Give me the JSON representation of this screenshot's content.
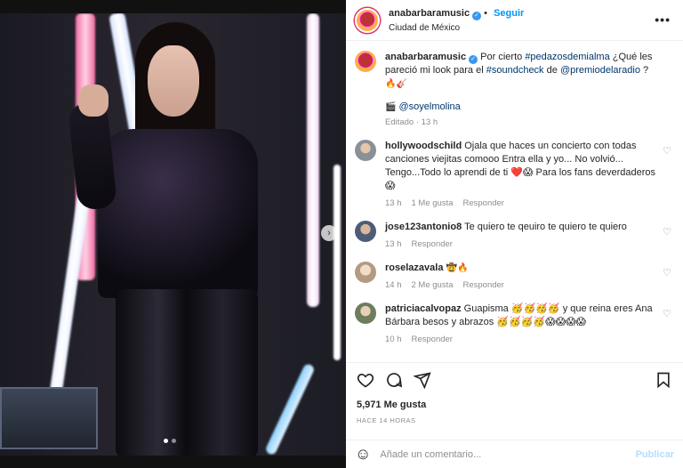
{
  "header": {
    "username": "anabarbaramusic",
    "follow_label": "Seguir",
    "location": "Ciudad de México",
    "more": "•••"
  },
  "caption": {
    "username": "anabarbaramusic",
    "text_1": "Por cierto",
    "hashtag_1": "#pedazosdemialma",
    "text_2": "¿Qué les pareció mi look para el",
    "hashtag_2": "#soundcheck",
    "text_3": "de",
    "mention": "@premiodelaradio",
    "text_4": "?",
    "emojis": "🔥🎸",
    "credit_icon": "🎬",
    "credit": "@soyelmolina",
    "edited": "Editado · 13 h"
  },
  "comments": [
    {
      "username": "hollywoodschild",
      "text": "Ojala que haces un concierto con todas canciones viejitas comooo Entra ella y yo... No volvió... Tengo...Todo lo aprendi de ti ❤️😱 Para los fans deverdaderos 😱",
      "time": "13 h",
      "likes": "1 Me gusta",
      "reply": "Responder",
      "avatar_color": "#9aa0a6"
    },
    {
      "username": "jose123antonio8",
      "text": "Te quiero te qeuiro te quiero te quiero",
      "time": "13 h",
      "likes": "",
      "reply": "Responder",
      "avatar_color": "#6b7b93"
    },
    {
      "username": "roselazavala",
      "text": "🤠🔥",
      "time": "14 h",
      "likes": "2 Me gusta",
      "reply": "Responder",
      "avatar_color": "#c8b49a"
    },
    {
      "username": "patriciacalvopaz",
      "text": "Guapisma 🥳🥳🥳🥳 y que reina eres Ana Bárbara besos y abrazos 🥳🥳🥳🥳😱😱😱😱",
      "time": "10 h",
      "likes": "",
      "reply": "Responder",
      "avatar_color": "#7f8c6a"
    }
  ],
  "likes_count": "5,971 Me gusta",
  "time_ago": "HACE 14 HORAS",
  "comment_box": {
    "placeholder": "Añade un comentario...",
    "post_label": "Publicar",
    "emoji_icon": "☺"
  },
  "colors": {
    "link": "#00376b",
    "follow": "#0095f6",
    "muted": "#8e8e8e",
    "post_disabled": "#b2dffc"
  }
}
